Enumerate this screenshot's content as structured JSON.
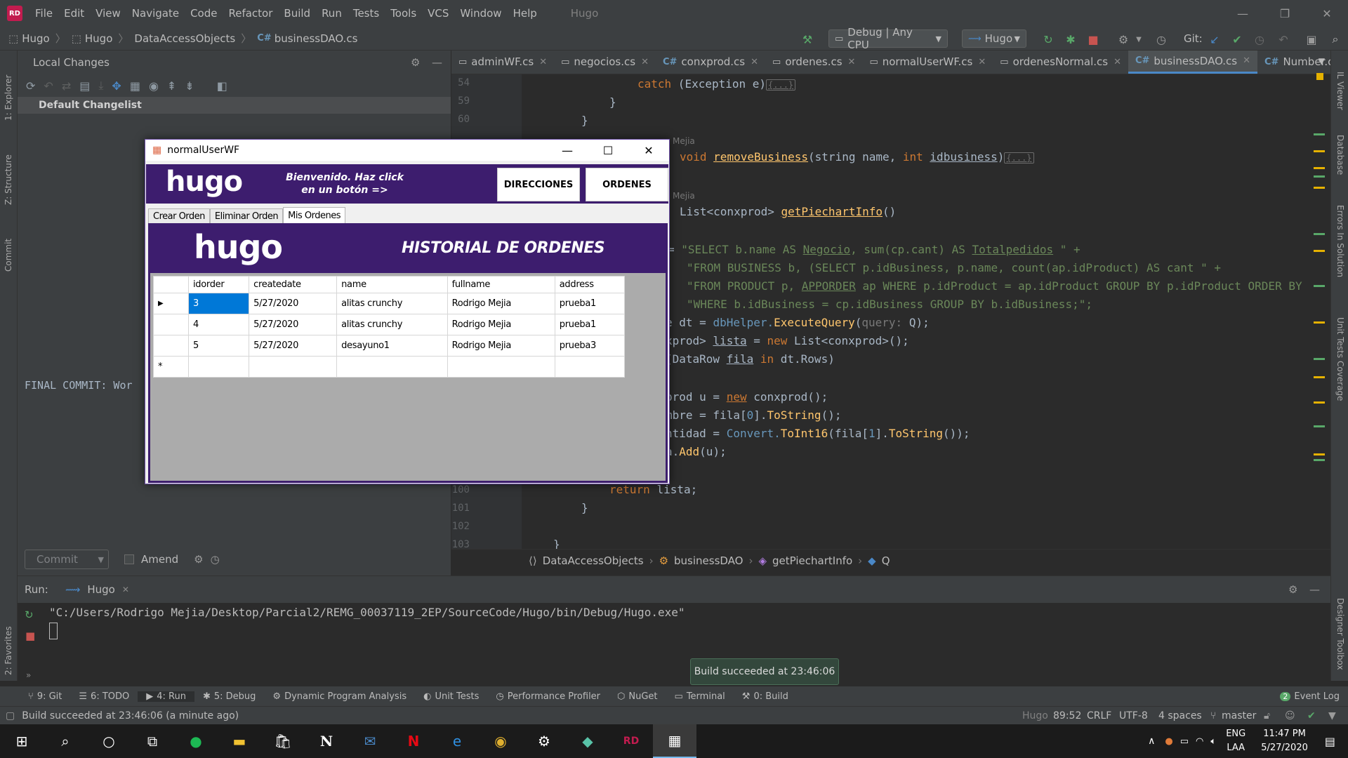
{
  "menubar": {
    "items": [
      "File",
      "Edit",
      "View",
      "Navigate",
      "Code",
      "Refactor",
      "Build",
      "Run",
      "Tests",
      "Tools",
      "VCS",
      "Window",
      "Help"
    ],
    "project": "Hugo"
  },
  "toolbar": {
    "breadcrumb": [
      "Hugo",
      "Hugo",
      "DataAccessObjects",
      "businessDAO.cs"
    ],
    "config": "Debug | Any CPU",
    "run_target": "Hugo",
    "git_label": "Git:"
  },
  "left_strip": {
    "explorer": "1: Explorer",
    "structure": "Z: Structure",
    "commit": "Commit",
    "favorites": "2: Favorites"
  },
  "right_strip": {
    "il_viewer": "IL Viewer",
    "database": "Database",
    "errors": "Errors In Solution",
    "coverage": "Unit Tests Coverage",
    "designer": "Designer Toolbox"
  },
  "local_changes": {
    "title": "Local Changes",
    "changelist": "Default Changelist",
    "commit_message": "FINAL COMMIT: Wor",
    "commit_button": "Commit",
    "amend_label": "Amend"
  },
  "editor_tabs": [
    {
      "label": "adminWF.cs",
      "icon": "form"
    },
    {
      "label": "negocios.cs",
      "icon": "form"
    },
    {
      "label": "conxprod.cs",
      "icon": "cs"
    },
    {
      "label": "ordenes.cs",
      "icon": "form"
    },
    {
      "label": "normalUserWF.cs",
      "icon": "form"
    },
    {
      "label": "ordenesNormal.cs",
      "icon": "form"
    },
    {
      "label": "businessDAO.cs",
      "icon": "cs",
      "active": true
    },
    {
      "label": "Number.cs",
      "icon": "cs"
    }
  ],
  "editor": {
    "lines": {
      "l54": "54",
      "l59": "59",
      "l60": "60",
      "l100": "100",
      "l101": "101",
      "l102": "102",
      "l103": "103"
    },
    "authors": [
      "Mejia",
      "Mejia"
    ],
    "code": {
      "catch_kw": "catch",
      "catch_rest": " (Exception e)",
      "fold1": "{...}",
      "brace1": "}",
      "brace2": "}",
      "remove_void": "void ",
      "remove_fn": "removeBusiness",
      "remove_params_a": "(string name, ",
      "remove_int": "int ",
      "remove_id": "idbusiness",
      ")": ")",
      "fold2": "{...}",
      "pie_type": "List<conxprod> ",
      "pie_fn": "getPiechartInfo",
      "pie_paren": "()",
      "q1_eq": "= ",
      "q1_str": "\"SELECT b.name AS ",
      "q1_neg": "Negocio",
      "q1_mid": ", sum(cp.cant) AS ",
      "q1_tot": "Totalpedidos",
      "q1_end": " \" +",
      "q2": "\"FROM BUSINESS b, (SELECT p.idBusiness, p.name, count(ap.idProduct) AS cant \" +",
      "q3_a": "\"FROM PRODUCT p, ",
      "q3_ap": "APPORDER",
      "q3_b": " ap WHERE p.idProduct = ap.idProduct GROUP BY p.idProduct ORDER BY",
      "q4": "\"WHERE b.idBusiness = cp.idBusiness GROUP BY b.idBusiness;\";",
      "dt_a": "e dt = ",
      "dt_b": "dbHelper.",
      "dt_fn": "ExecuteQuery",
      "dt_hint": "query: ",
      "dt_c": "Q);",
      "lista_a": "xprod> ",
      "lista_b": "lista",
      "lista_c": " = ",
      "lista_new": "new ",
      "lista_d": "List<conxprod>();",
      "foreach_a": "(DataRow ",
      "foreach_fila": "fila",
      "foreach_in": " in ",
      "foreach_b": "dt.Rows)",
      "u_a": "prod u = ",
      "u_new": "new",
      "u_b": " conxprod();",
      "nombre_a": "mbre = fila[",
      "nombre_0": "0",
      "nombre_b": "].",
      "nombre_fn": "ToString",
      "nombre_c": "();",
      "cant_a": "ntidad = ",
      "cant_b": "Convert.",
      "cant_fn": "ToInt16",
      "cant_c": "(fila[",
      "cant_1": "1",
      "cant_d": "].",
      "cant_fn2": "ToString",
      "cant_e": "());",
      "add_a": "a.",
      "add_fn": "Add",
      "add_b": "(u);",
      "return_kw": "return ",
      "return_b": "lista;",
      "brace3": "}",
      "brace4": "}"
    }
  },
  "breadbar": [
    "DataAccessObjects",
    "businessDAO",
    "getPiechartInfo",
    "Q"
  ],
  "run": {
    "label": "Run:",
    "tab": "Hugo",
    "output": "\"C:/Users/Rodrigo Mejia/Desktop/Parcial2/REMG_00037119_2EP/SourceCode/Hugo/bin/Debug/Hugo.exe\""
  },
  "toast": "Build succeeded at 23:46:06",
  "bottom_tools": [
    {
      "label": "9: Git",
      "icon": "git-icon"
    },
    {
      "label": "6: TODO",
      "icon": "todo-icon"
    },
    {
      "label": "4: Run",
      "icon": "run-icon"
    },
    {
      "label": "5: Debug",
      "icon": "debug-icon"
    },
    {
      "label": "Dynamic Program Analysis",
      "icon": "analysis-icon"
    },
    {
      "label": "Unit Tests",
      "icon": "unit-tests-icon"
    },
    {
      "label": "Performance Profiler",
      "icon": "profiler-icon"
    },
    {
      "label": "NuGet",
      "icon": "nuget-icon"
    },
    {
      "label": "Terminal",
      "icon": "terminal-icon"
    },
    {
      "label": "0: Build",
      "icon": "build-icon"
    }
  ],
  "event_log": {
    "count": "2",
    "label": "Event Log"
  },
  "status": {
    "message": "Build succeeded at 23:46:06 (a minute ago)",
    "project": "Hugo",
    "position": "89:52",
    "line_ending": "CRLF",
    "encoding": "UTF-8",
    "indent": "4 spaces",
    "branch": "master"
  },
  "taskbar": {
    "lang": "ENG",
    "layout": "LAA",
    "time": "11:47 PM",
    "date": "5/27/2020"
  },
  "winform": {
    "title": "normalUserWF",
    "logo": "hugo",
    "welcome": "Bienvenido. Haz click en un botón =>",
    "btn_direcciones": "DIRECCIONES",
    "btn_ordenes": "ORDENES",
    "tabs": [
      "Crear Orden",
      "Eliminar Orden",
      "Mis Ordenes"
    ],
    "banner_logo": "hugo",
    "banner_title": "HISTORIAL DE ORDENES",
    "columns": [
      "idorder",
      "createdate",
      "name",
      "fullname",
      "address"
    ],
    "rows": [
      [
        "3",
        "5/27/2020",
        "alitas crunchy",
        "Rodrigo Mejia",
        "prueba1"
      ],
      [
        "4",
        "5/27/2020",
        "alitas crunchy",
        "Rodrigo Mejia",
        "prueba1"
      ],
      [
        "5",
        "5/27/2020",
        "desayuno1",
        "Rodrigo Mejia",
        "prueba3"
      ]
    ],
    "current_row_marker": "▶",
    "new_row_marker": "*"
  }
}
